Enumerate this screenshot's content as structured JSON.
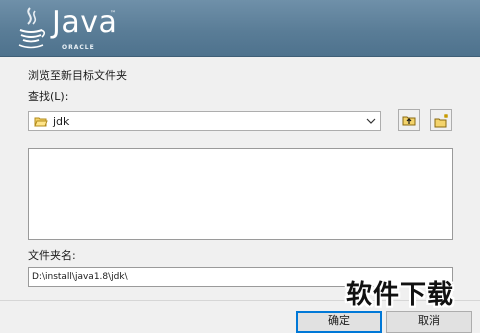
{
  "header": {
    "logo_wordmark": "Java",
    "logo_tm": "™",
    "logo_company": "ORACLE"
  },
  "dialog": {
    "instruction": "浏览至新目标文件夹",
    "look_in_label": "查找(L):",
    "look_in_value": "jdk",
    "folder_name_label": "文件夹名:",
    "folder_name_value": "D:\\install\\java1.8\\jdk\\",
    "ok_label": "确定",
    "cancel_label": "取消"
  },
  "overlay": {
    "watermark": "软件下载"
  },
  "icons": {
    "combo_icon": "folder-icon",
    "dropdown_icon": "chevron-down-icon",
    "up_button_icon": "folder-up-icon",
    "new_folder_button_icon": "new-folder-icon"
  },
  "colors": {
    "header_blue": "#5a7d97",
    "dialog_bg": "#f0f0f0",
    "default_button_border": "#0078d7"
  }
}
